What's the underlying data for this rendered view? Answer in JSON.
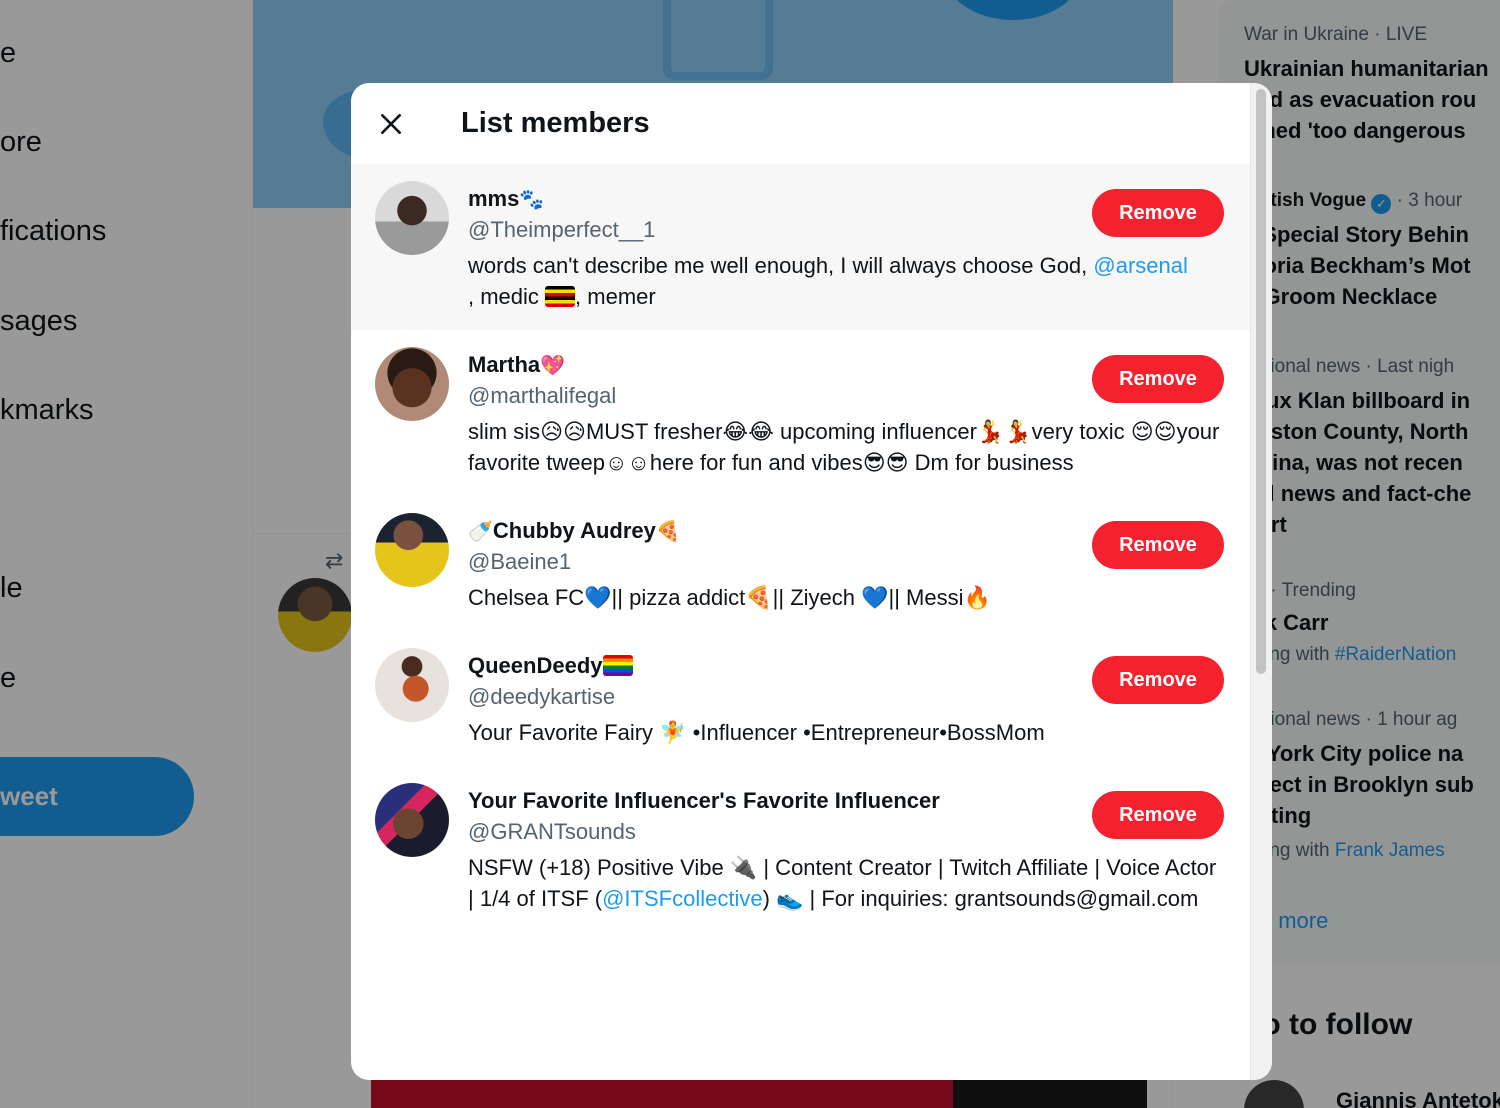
{
  "left_nav": {
    "items": [
      "e",
      "ore",
      "fications",
      "sages",
      "kmarks",
      "le",
      "e"
    ],
    "tweet_button": "weet"
  },
  "right_sidebar": {
    "trends": [
      {
        "meta": "War in Ukraine · LIVE",
        "lines": [
          "Ukrainian humanitarian",
          "lted as evacuation rou",
          "emed 'too dangerous"
        ]
      },
      {
        "meta_name": "British Vogue",
        "meta_time": "· 3 hour",
        "lines": [
          "e Special Story Behin",
          "ctoria Beckham’s Mot",
          "e-Groom Necklace"
        ]
      },
      {
        "meta": "national news · Last nigh",
        "lines": [
          "Klux Klan billboard in",
          "nnston County, North",
          "rolina, was not recen",
          "cal news and fact-che",
          "port"
        ]
      },
      {
        "meta": "rts · Trending",
        "lines": [
          "rek Carr"
        ],
        "trending_prefix": "nding with",
        "trending_tag": "#RaiderNation"
      },
      {
        "meta": "national news · 1 hour ag",
        "lines": [
          "w York City police na",
          "spect in Brooklyn sub",
          "ooting"
        ],
        "trending_prefix": "nding with",
        "trending_tag": "Frank James"
      }
    ],
    "show_more": "ow more",
    "who_to_follow": "ho to follow",
    "follow_name": "Giannis Antetok"
  },
  "modal": {
    "title": "List members",
    "remove_label": "Remove",
    "members": [
      {
        "name": "mms",
        "name_emoji_after": "🐾",
        "handle": "@Theimperfect__1",
        "bio_1": "words can't describe me well enough, I will always choose God, ",
        "bio_link": "@arsenal",
        "bio_2": ", medic ",
        "bio_3": ", memer"
      },
      {
        "name": "Martha",
        "name_emoji_after": "💖",
        "handle": "@marthalifegal",
        "bio": "slim sis😥😥MUST fresher😂😂 upcoming influencer💃💃very toxic 😌😌your favorite tweep☺☺here for fun and vibes😎😎 Dm for business"
      },
      {
        "name_emoji_before": "🍼",
        "name": "Chubby Audrey",
        "name_emoji_after": "🍕",
        "handle": "@Baeine1",
        "bio": "Chelsea FC💙|| pizza addict🍕|| Ziyech 💙|| Messi🔥"
      },
      {
        "name": "QueenDeedy",
        "handle": "@deedykartise",
        "bio": "Your Favorite Fairy 🧚 •Influencer •Entrepreneur•BossMom"
      },
      {
        "name": "Your Favorite Influencer's Favorite Influencer",
        "handle": "@GRANTsounds",
        "bio_1": "NSFW (+18) Positive Vibe 🔌 | Content Creator | Twitch Affiliate | Voice Actor | 1/4 of ITSF (",
        "bio_link": "@ITSFcollective",
        "bio_2": ") 👟 | For inquiries: grantsounds@gmail.com"
      }
    ]
  },
  "icons": {
    "close": "close-icon",
    "retweet": "retweet-icon",
    "verified": "verified-badge-icon"
  },
  "colors": {
    "accent": "#1d9bf0",
    "remove": "#f4212e",
    "hover_row": "#f7f7f7"
  }
}
